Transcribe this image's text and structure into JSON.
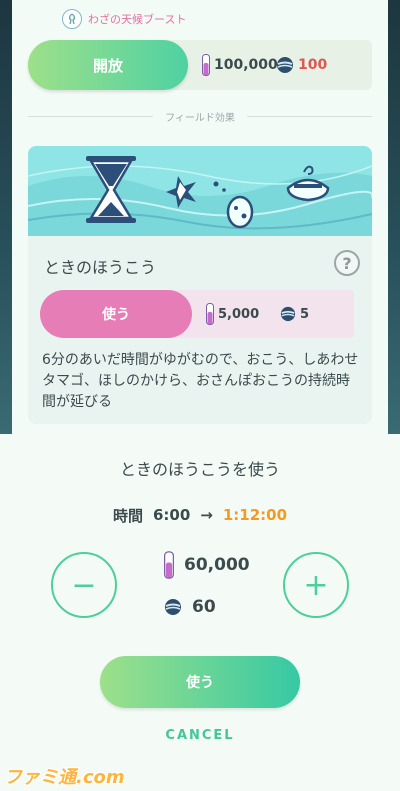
{
  "upper": {
    "weather_boost_label": "わざの天候ブースト",
    "unlock_button_label": "開放",
    "unlock_stardust": "100,000",
    "unlock_candy": "100",
    "section_label": "フィールド効果"
  },
  "effect": {
    "name": "ときのほうこう",
    "help_symbol": "?",
    "use_button_label": "使う",
    "stardust_cost": "5,000",
    "candy_cost": "5",
    "description": "6分のあいだ時間がゆがむので、おこう、しあわせタマゴ、ほしのかけら、おさんぽおこうの持続時間が延びる"
  },
  "sheet": {
    "title": "ときのほうこうを使う",
    "time_label": "時間",
    "time_from": "6:00",
    "arrow": "→",
    "time_to": "1:12:00",
    "decrease_symbol": "−",
    "increase_symbol": "+",
    "stardust_total": "60,000",
    "candy_total": "60",
    "use_button_label": "使う",
    "cancel_label": "CANCEL"
  },
  "watermark": "ファミ通.com",
  "colors": {
    "primary_green": "#4fd1a2",
    "pink": "#e77db6",
    "orange_time": "#f39a22",
    "candy_red": "#e25550"
  }
}
